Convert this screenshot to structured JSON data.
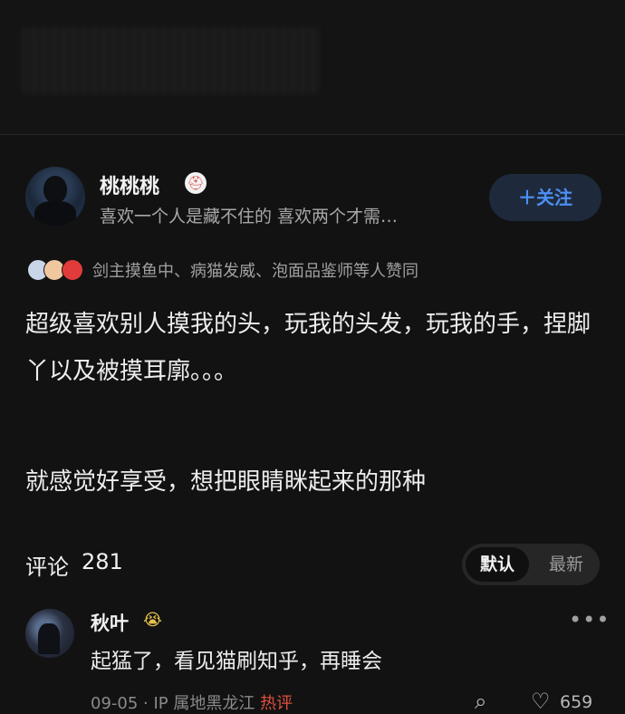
{
  "author": {
    "name": "桃桃桃",
    "bio": "喜欢一个人是藏不住的 喜欢两个才需…",
    "follow_label": "＋关注",
    "badge_icon": "⛑"
  },
  "likers": {
    "text": "剑主摸鱼中、病猫发威、泡面品鉴师等人赞同",
    "colors": [
      "#c9d6e8",
      "#f0c8a0",
      "#e23b3b"
    ]
  },
  "post": {
    "paragraph_1": "超级喜欢别人摸我的头，玩我的头发，玩我的手，捏脚丫以及被摸耳廓。。。",
    "paragraph_2": "就感觉好享受，想把眼睛眯起来的那种"
  },
  "comments_header": {
    "title": "评论",
    "count": "281",
    "sort_default": "默认",
    "sort_newest": "最新"
  },
  "comment": {
    "user": "秋叶",
    "badge_icon": "😭",
    "more_icon": "•••",
    "text": "起猛了，看见猫刷知乎，再睡会",
    "date": "09-05",
    "ip": "IP 属地黑龙江",
    "hot_tag": "热评",
    "search_icon": "⌕",
    "like_icon": "♡",
    "likes": "659"
  },
  "colors": {
    "background": "#121212",
    "accent": "#4d8ff5",
    "hot": "#e0503f"
  }
}
